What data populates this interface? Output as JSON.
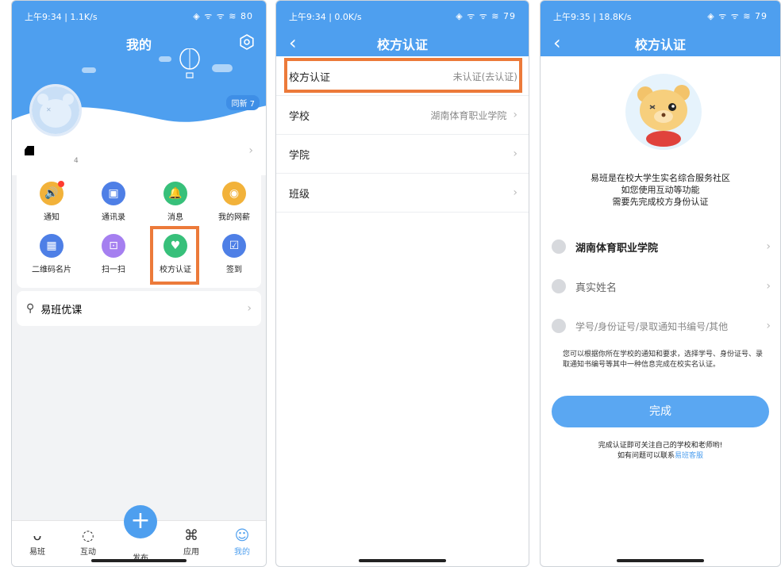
{
  "panel1": {
    "status": {
      "time": "上午9:34 | 1.1K/s",
      "right": "◈ ᯤ ᯤ ≋ 80"
    },
    "title": "我的",
    "badge": "同新 7",
    "user_count": "4",
    "grid": [
      {
        "label": "通知",
        "icon": "speaker-icon",
        "color": "#f2b23a"
      },
      {
        "label": "通讯录",
        "icon": "contacts-icon",
        "color": "#4e7fe6"
      },
      {
        "label": "消息",
        "icon": "bell-icon",
        "color": "#37c07a"
      },
      {
        "label": "我的网薪",
        "icon": "coins-icon",
        "color": "#f2b23a"
      },
      {
        "label": "二维码名片",
        "icon": "qrcode-icon",
        "color": "#4e7fe6"
      },
      {
        "label": "扫一扫",
        "icon": "scan-icon",
        "color": "#a57ff0"
      },
      {
        "label": "校方认证",
        "icon": "verify-icon",
        "color": "#37c07a"
      },
      {
        "label": "签到",
        "icon": "calendar-icon",
        "color": "#4e7fe6"
      }
    ],
    "course": "易班优课",
    "tabs": [
      "易班",
      "互动",
      "发布",
      "应用",
      "我的"
    ]
  },
  "panel2": {
    "status": {
      "time": "上午9:34 | 0.0K/s",
      "right": "◈ ᯤ ᯤ ≋ 79"
    },
    "title": "校方认证",
    "rows": [
      {
        "label": "校方认证",
        "value": "未认证(去认证)"
      },
      {
        "label": "学校",
        "value": "湖南体育职业学院"
      },
      {
        "label": "学院",
        "value": ""
      },
      {
        "label": "班级",
        "value": ""
      }
    ]
  },
  "panel3": {
    "status": {
      "time": "上午9:35 | 18.8K/s",
      "right": "◈ ᯤ ᯤ ≋ 79"
    },
    "title": "校方认证",
    "intro1": "易班是在校大学生实名综合服务社区",
    "intro2": "如您使用互动等功能",
    "intro3": "需要先完成校方身份认证",
    "school": "湖南体育职业学院",
    "name_placeholder": "真实姓名",
    "id_placeholder": "学号/身份证号/录取通知书编号/其他",
    "hint": "您可以根据你所在学校的通知和要求，选择学号、身份证号、录取通知书编号等其中一种信息完成在校实名认证。",
    "done": "完成",
    "foot1": "完成认证即可关注自己的学校和老师哟!",
    "foot2": "如有问题可以联系",
    "foot_link": "易班客服"
  },
  "colors": {
    "primary": "#4e9fef",
    "highlight": "#ec7a3a"
  }
}
